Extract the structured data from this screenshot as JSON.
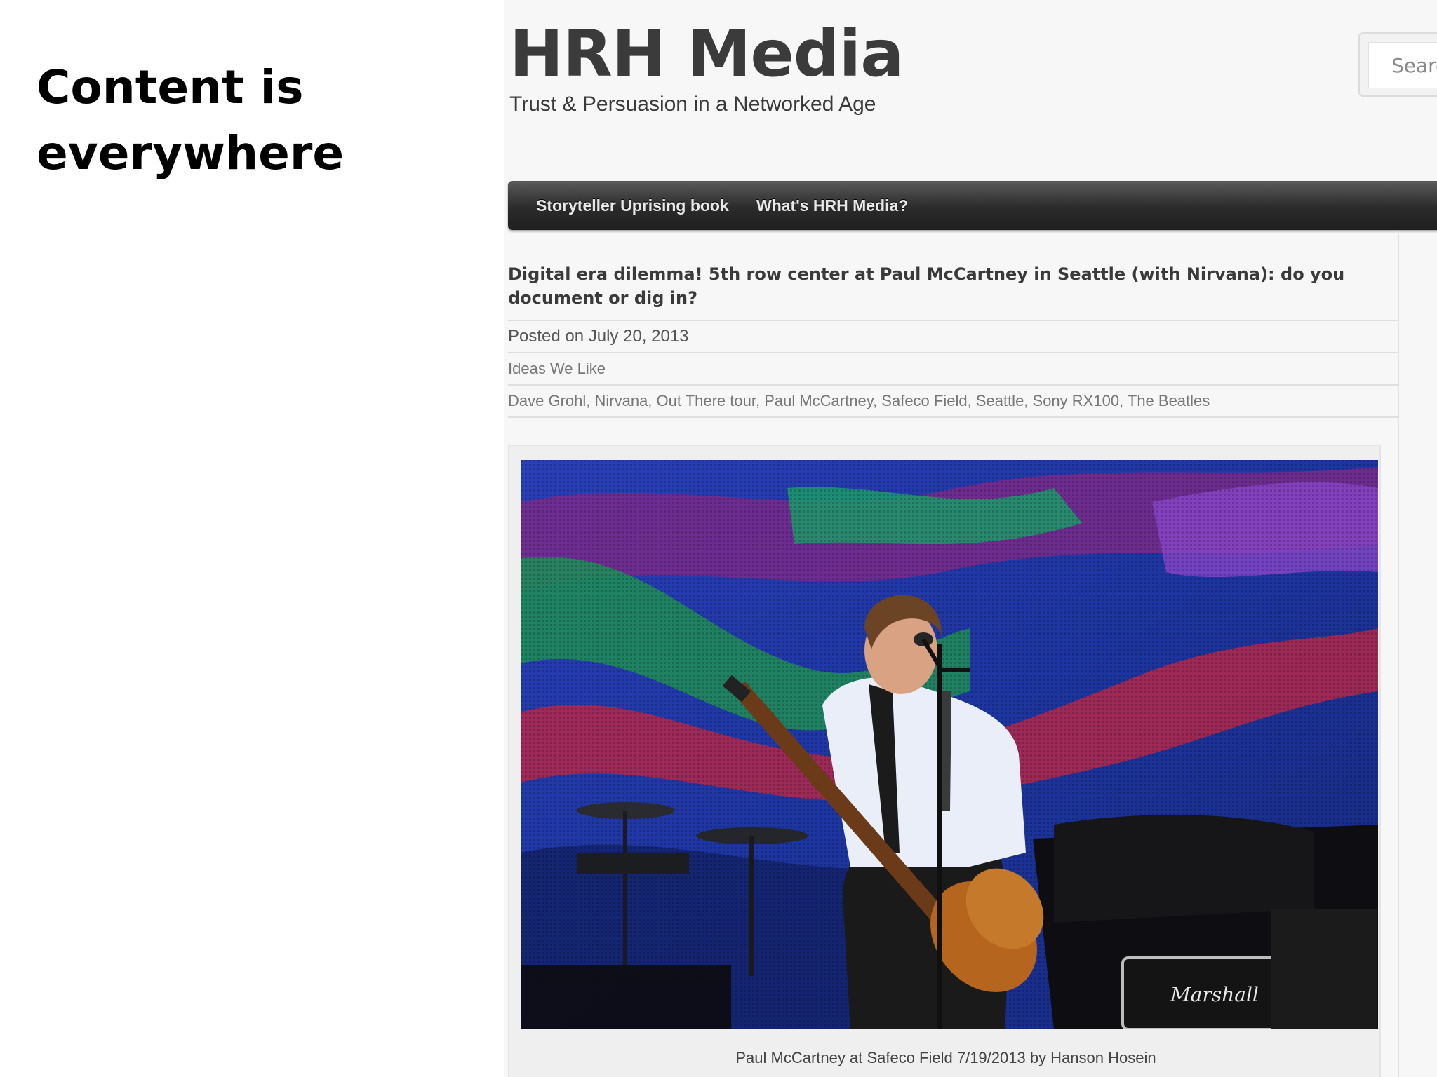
{
  "slide": {
    "title_line1": "Content is",
    "title_line2": "everywhere"
  },
  "site": {
    "logo": "HRH Media",
    "tagline": "Trust & Persuasion in a Networked Age",
    "search_placeholder": "Search"
  },
  "nav": {
    "items": [
      {
        "label": "Storyteller Uprising book"
      },
      {
        "label": "What's HRH Media?"
      }
    ]
  },
  "post": {
    "title": "Digital era dilemma! 5th row center at Paul McCartney in Seattle (with Nirvana): do you document or dig in?",
    "posted_on": "Posted on July 20, 2013",
    "category": "Ideas We Like",
    "tags": "Dave Grohl, Nirvana, Out There tour, Paul McCartney, Safeco Field, Seattle, Sony RX100, The Beatles",
    "photo": {
      "amp_logo": "Marshall",
      "caption": "Paul McCartney at Safeco Field 7/19/2013 by Hanson Hosein"
    }
  },
  "colors": {
    "nav_bar": "#2b2b2b",
    "logo_text": "#3b3b3b",
    "stage_blue": "#1e3aa8"
  }
}
